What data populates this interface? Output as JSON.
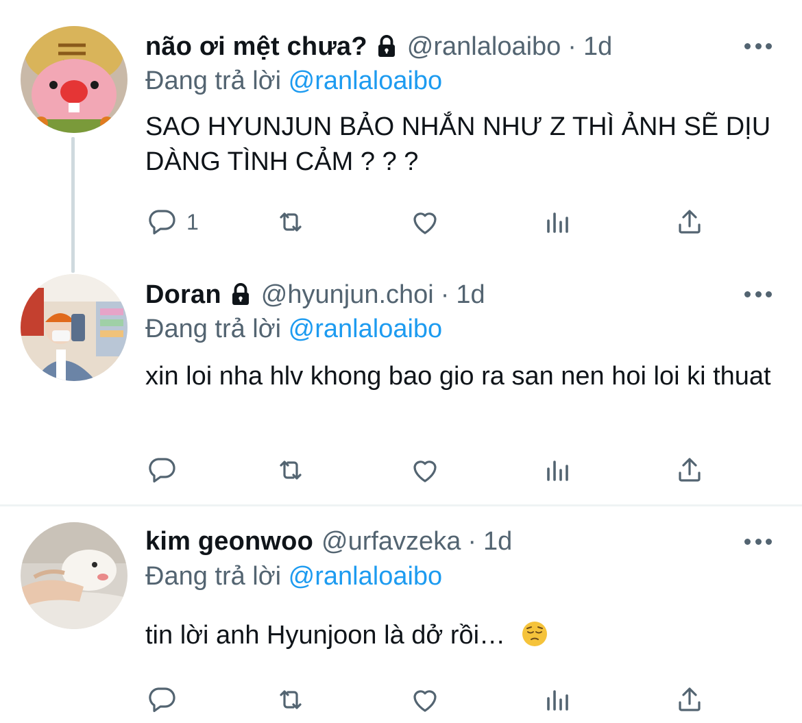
{
  "colors": {
    "text": "#0f1419",
    "secondary": "#536471",
    "link": "#1d9bf0",
    "divider": "#eff3f4",
    "thread_line": "#cfd9de"
  },
  "icons": {
    "reply": "speech-bubble-icon",
    "retweet": "retweet-arrows-icon",
    "like": "heart-outline-icon",
    "views": "bar-chart-icon",
    "share": "share-upload-icon",
    "more": "more-dots-icon",
    "protected": "lock-icon"
  },
  "tweets": [
    {
      "name": "não ơi mệt chưa?",
      "handle": "@ranlaloaibo",
      "separator": "·",
      "time": "1d",
      "reply_prefix": "Đang trả lời",
      "reply_to": "@ranlaloaibo",
      "text": "SAO HYUNJUN BẢO NHẮN NHƯ Z THÌ ẢNH SẼ DỊU DÀNG TÌNH CẢM ? ? ?",
      "reply_count": "1"
    },
    {
      "name": "Doran",
      "handle": "@hyunjun.choi",
      "separator": "·",
      "time": "1d",
      "reply_prefix": "Đang trả lời",
      "reply_to": "@ranlaloaibo",
      "text": "xin loi nha hlv khong bao gio ra san nen hoi loi ki thuat",
      "reply_count": ""
    },
    {
      "name": "kim geonwoo",
      "handle": "@urfavzeka",
      "separator": "·",
      "time": "1d",
      "reply_prefix": "Đang trả lời",
      "reply_to": "@ranlaloaibo",
      "text": "tin lời anh Hyunjoon là dở rồi…",
      "reply_count": ""
    }
  ]
}
